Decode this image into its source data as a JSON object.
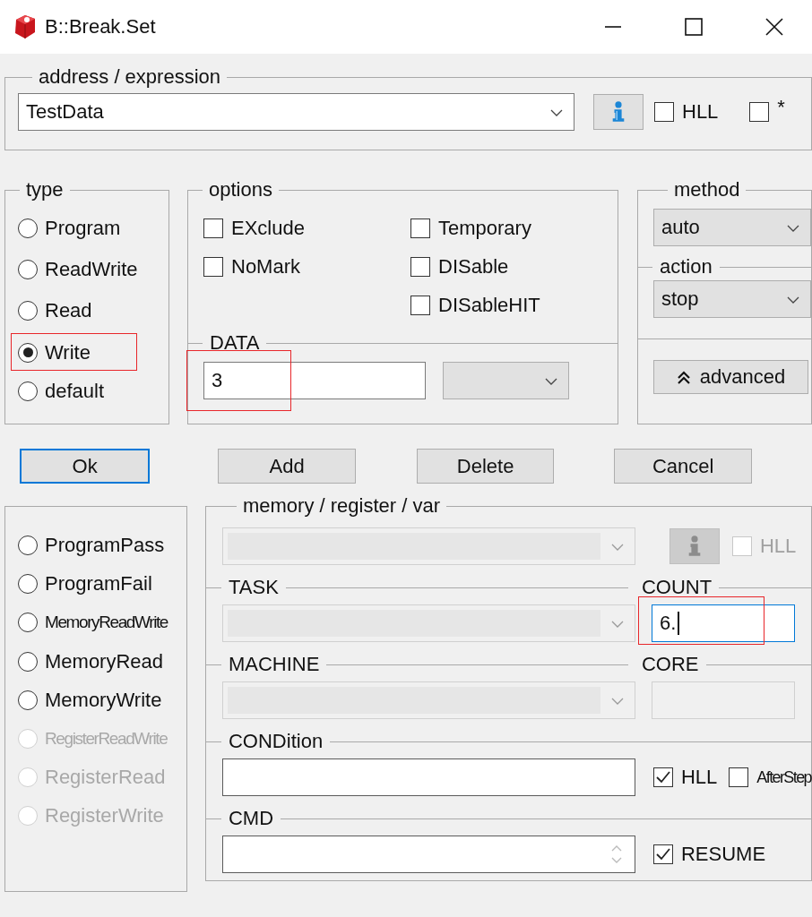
{
  "window": {
    "title": "B::Break.Set"
  },
  "address": {
    "label": "address / expression",
    "value": "TestData",
    "hll": {
      "label": "HLL",
      "checked": false
    },
    "star": {
      "label": "*",
      "checked": false
    }
  },
  "type": {
    "label": "type",
    "options": [
      {
        "label": "Program",
        "selected": false,
        "highlighted": false
      },
      {
        "label": "ReadWrite",
        "selected": false,
        "highlighted": false
      },
      {
        "label": "Read",
        "selected": false,
        "highlighted": false
      },
      {
        "label": "Write",
        "selected": true,
        "highlighted": true
      },
      {
        "label": "default",
        "selected": false,
        "highlighted": false
      }
    ]
  },
  "options": {
    "label": "options",
    "left": [
      {
        "label": "EXclude",
        "checked": false
      },
      {
        "label": "NoMark",
        "checked": false
      }
    ],
    "right": [
      {
        "label": "Temporary",
        "checked": false
      },
      {
        "label": "DISable",
        "checked": false
      },
      {
        "label": "DISableHIT",
        "checked": false
      }
    ]
  },
  "data": {
    "label": "DATA",
    "value": "3",
    "highlighted": true
  },
  "method": {
    "label": "method",
    "value": "auto"
  },
  "action": {
    "label": "action",
    "value": "stop"
  },
  "advanced": {
    "label": "advanced"
  },
  "buttons": [
    {
      "label": "Ok",
      "default": true
    },
    {
      "label": "Add",
      "default": false
    },
    {
      "label": "Delete",
      "default": false
    },
    {
      "label": "Cancel",
      "default": false
    }
  ],
  "events": [
    {
      "label": "ProgramPass",
      "selected": false,
      "disabled": false,
      "narrow": false
    },
    {
      "label": "ProgramFail",
      "selected": false,
      "disabled": false,
      "narrow": false
    },
    {
      "label": "MemoryReadWrite",
      "selected": false,
      "disabled": false,
      "narrow": true
    },
    {
      "label": "MemoryRead",
      "selected": false,
      "disabled": false,
      "narrow": false
    },
    {
      "label": "MemoryWrite",
      "selected": false,
      "disabled": false,
      "narrow": false
    },
    {
      "label": "RegisterReadWrite",
      "selected": false,
      "disabled": true,
      "narrow": true
    },
    {
      "label": "RegisterRead",
      "selected": false,
      "disabled": true,
      "narrow": false
    },
    {
      "label": "RegisterWrite",
      "selected": false,
      "disabled": true,
      "narrow": false
    }
  ],
  "memory": {
    "label": "memory / register / var",
    "disabled": true,
    "hll": {
      "label": "HLL",
      "checked": false,
      "disabled": true
    }
  },
  "task": {
    "label": "TASK",
    "disabled": true
  },
  "count": {
    "label": "COUNT",
    "value": "6.",
    "focused": true,
    "highlighted": true
  },
  "machine": {
    "label": "MACHINE",
    "disabled": true
  },
  "core": {
    "label": "CORE",
    "disabled": true
  },
  "condition": {
    "label": "CONDition",
    "hll": {
      "label": "HLL",
      "checked": true
    },
    "afterstep": {
      "label": "AfterStep",
      "checked": false
    }
  },
  "cmd": {
    "label": "CMD",
    "resume": {
      "label": "RESUME",
      "checked": true
    }
  }
}
